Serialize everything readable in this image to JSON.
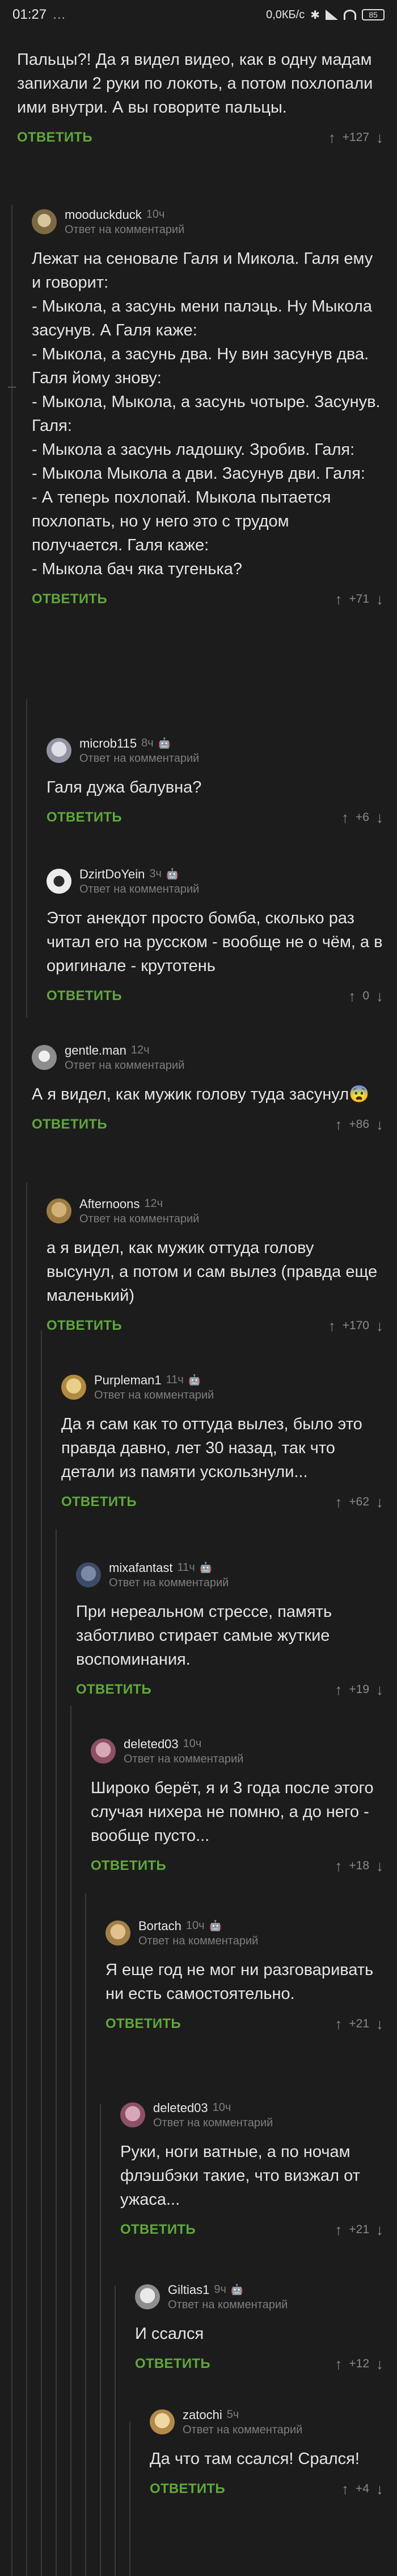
{
  "status_bar": {
    "time": "01:27",
    "notif": "…",
    "speed": "0,0КБ/с",
    "battery": "85"
  },
  "comments": [
    {
      "user": "",
      "time": "",
      "reply_to": "",
      "text": "Пальцы?! Да я видел видео, как в одну мадам запихали 2 руки по локоть, а потом похлопали ими внутри. А вы говорите пальцы.",
      "reply_label": "ОТВЕТИТЬ",
      "score": "+127"
    },
    {
      "user": "mooduckduck",
      "time": "10ч",
      "reply_to": "Ответ на комментарий",
      "text": "Лежат на сеновале Галя и Микола. Галя ему и говорит:\n- Мыкола, а засунь мени палэць. Ну Мыкола засунув. А Галя каже:\n- Мыкола, а засунь два. Ну вин засунув два. Галя йому знову:\n- Мыкола, Мыкола, а засунь чотыре. Засунув. Галя:\n- Мыкола а засунь ладошку. Зробив. Галя:\n- Мыкола Мыкола а дви. Засунув дви. Галя:\n- А теперь похлопай. Мыкола пытается похлопать, но у него это с трудом получается. Галя каже:\n- Мыкола бач яка тугенька?",
      "reply_label": "ОТВЕТИТЬ",
      "score": "+71"
    },
    {
      "user": "microb115",
      "time": "8ч",
      "reply_to": "Ответ на комментарий",
      "text": "Галя дужа балувна?",
      "reply_label": "ОТВЕТИТЬ",
      "score": "+6"
    },
    {
      "user": "DzirtDoYein",
      "time": "3ч",
      "reply_to": "Ответ на комментарий",
      "text": "Этот анекдот просто бомба, сколько раз читал его на русском - вообще не о чём, а в оригинале - крутотень",
      "reply_label": "ОТВЕТИТЬ",
      "score": "0"
    },
    {
      "user": "gentle.man",
      "time": "12ч",
      "reply_to": "Ответ на комментарий",
      "text": "А я видел, как мужик голову туда засунул😨",
      "reply_label": "ОТВЕТИТЬ",
      "score": "+86"
    },
    {
      "user": "Afternoons",
      "time": "12ч",
      "reply_to": "Ответ на комментарий",
      "text": "а я видел, как мужик оттуда голову высунул, а потом и сам вылез (правда еще маленький)",
      "reply_label": "ОТВЕТИТЬ",
      "score": "+170"
    },
    {
      "user": "Purpleman1",
      "time": "11ч",
      "reply_to": "Ответ на комментарий",
      "text": "Да я сам как то оттуда вылез, было это правда давно, лет 30 назад, так что детали из памяти ускользнули...",
      "reply_label": "ОТВЕТИТЬ",
      "score": "+62"
    },
    {
      "user": "mixafantast",
      "time": "11ч",
      "reply_to": "Ответ на комментарий",
      "text": "При нереальном стрессе, память заботливо стирает самые жуткие воспоминания.",
      "reply_label": "ОТВЕТИТЬ",
      "score": "+19"
    },
    {
      "user": "deleted03",
      "time": "10ч",
      "reply_to": "Ответ на комментарий",
      "text": "Широко берёт, я и 3 года после этого случая нихера не помню, а до него - вообще пусто...",
      "reply_label": "ОТВЕТИТЬ",
      "score": "+18"
    },
    {
      "user": "Bortach",
      "time": "10ч",
      "reply_to": "Ответ на комментарий",
      "text": "Я еще год не мог ни разговаривать ни есть самостоятельно.",
      "reply_label": "ОТВЕТИТЬ",
      "score": "+21"
    },
    {
      "user": "deleted03",
      "time": "10ч",
      "reply_to": "Ответ на комментарий",
      "text": "Руки, ноги ватные, а по ночам флэшбэки такие, что визжал от ужаса...",
      "reply_label": "ОТВЕТИТЬ",
      "score": "+21"
    },
    {
      "user": "Giltias1",
      "time": "9ч",
      "reply_to": "Ответ на комментарий",
      "text": "И ссался",
      "reply_label": "ОТВЕТИТЬ",
      "score": "+12"
    },
    {
      "user": "zatochi",
      "time": "5ч",
      "reply_to": "Ответ на комментарий",
      "text": "Да что там ссался! Срался!",
      "reply_label": "ОТВЕТИТЬ",
      "score": "+4"
    }
  ],
  "icons": {
    "upvote": "arrow-up-icon",
    "downvote": "arrow-down-icon",
    "android": "android-icon",
    "apple": "apple-icon"
  },
  "colors": {
    "background": "#1c1c1c",
    "accent": "#5fa83a",
    "muted": "#7d7d7d"
  }
}
